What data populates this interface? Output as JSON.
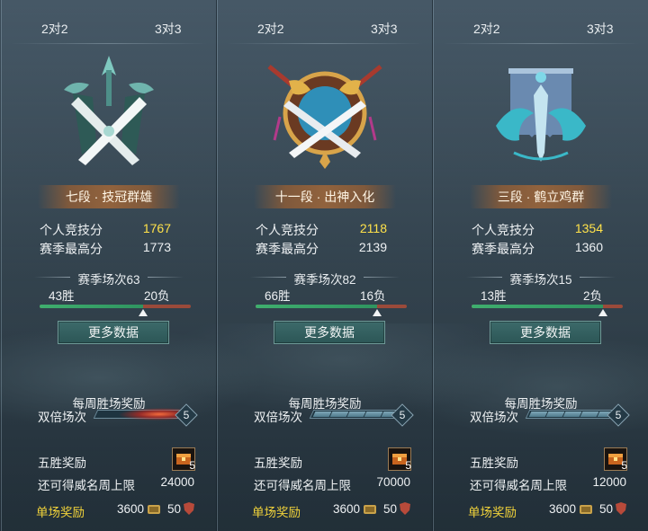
{
  "tabs": [
    "2对2",
    "3对3"
  ],
  "labels": {
    "personal_score": "个人竞技分",
    "season_max": "赛季最高分",
    "more": "更多数据",
    "weekly_reward": "每周胜场奖励",
    "double": "双倍场次",
    "five_win": "五胜奖励",
    "cap": "还可得威名周上限",
    "single_reward": "单场奖励"
  },
  "panels": [
    {
      "rank": "七段 · 技冠群雄",
      "score": "1767",
      "max": "1773",
      "season": "赛季场次63",
      "wins": "43胜",
      "losses": "20负",
      "win_ratio": 0.6825,
      "double_count": "5",
      "chest_count": "5",
      "cap_value": "24000",
      "reward_coins": "3600",
      "reward_shield": "50"
    },
    {
      "rank": "十一段 · 出神入化",
      "score": "2118",
      "max": "2139",
      "season": "赛季场次82",
      "wins": "66胜",
      "losses": "16负",
      "win_ratio": 0.8049,
      "double_count": "5",
      "chest_count": "5",
      "cap_value": "70000",
      "reward_coins": "3600",
      "reward_shield": "50"
    },
    {
      "rank": "三段 · 鹤立鸡群",
      "score": "1354",
      "max": "1360",
      "season": "赛季场次15",
      "wins": "13胜",
      "losses": "2负",
      "win_ratio": 0.8667,
      "double_count": "5",
      "chest_count": "5",
      "cap_value": "12000",
      "reward_coins": "3600",
      "reward_shield": "50"
    }
  ],
  "colors": {
    "score": "#ffe24a",
    "single_reward": "#f0d23a",
    "win_bar": "#3fae6e",
    "loss_bar": "#9a4a3a"
  }
}
